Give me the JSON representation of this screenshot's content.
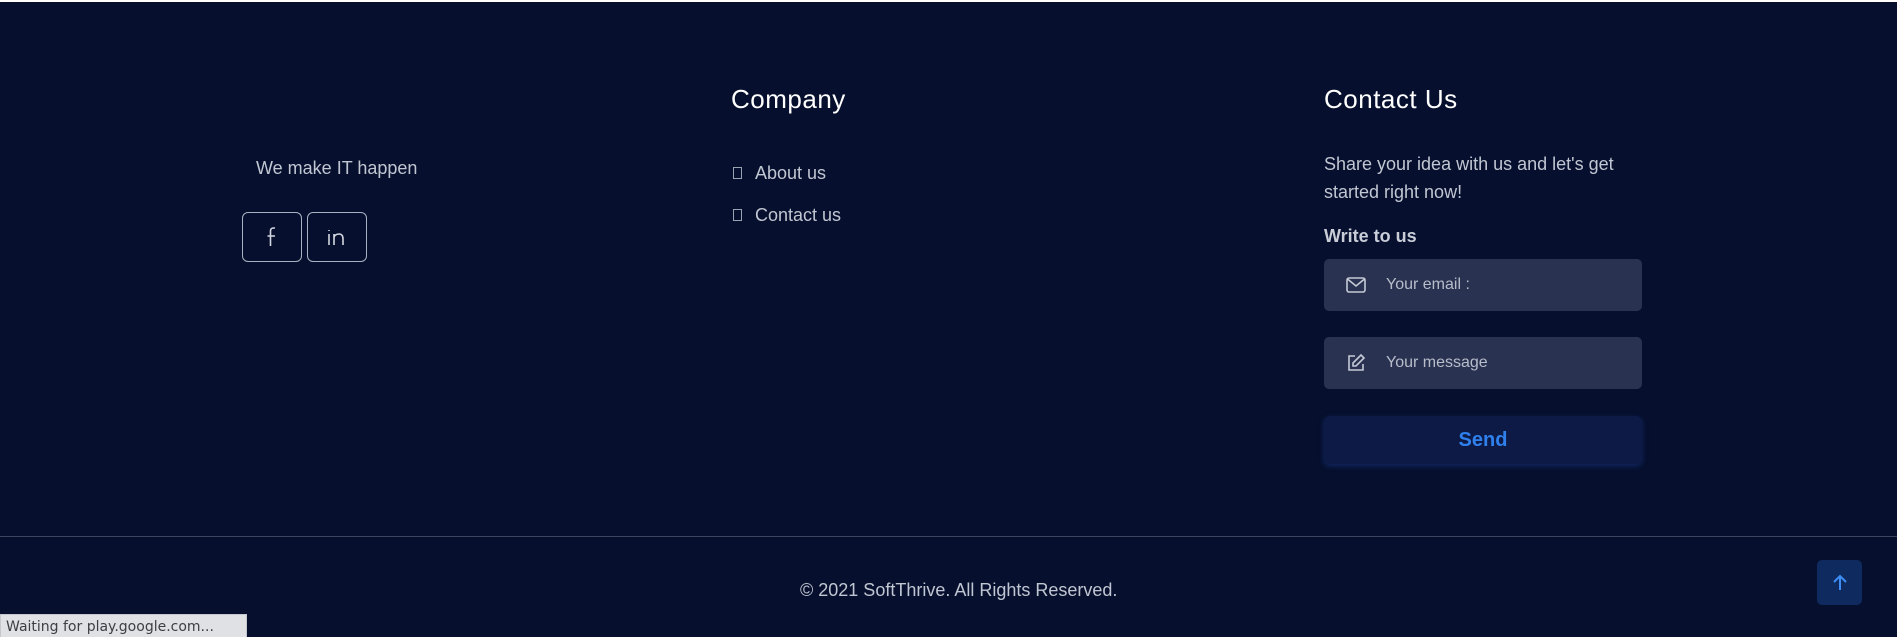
{
  "brand": {
    "tagline": "We make IT happen"
  },
  "socials": [
    {
      "name": "facebook-icon"
    },
    {
      "name": "linkedin-icon"
    }
  ],
  "company": {
    "heading": "Company",
    "links": [
      {
        "label": "About us"
      },
      {
        "label": "Contact us"
      }
    ]
  },
  "contact": {
    "heading": "Contact Us",
    "description": "Share your idea with us and let's get started right now!",
    "write_label": "Write to us",
    "email_placeholder": "Your email :",
    "message_placeholder": "Your message",
    "send_label": "Send"
  },
  "footer": {
    "copyright": "© 2021 SoftThrive. All Rights Reserved."
  },
  "status_bar": {
    "text": "Waiting for play.google.com..."
  },
  "colors": {
    "background": "#060f2d",
    "field_bg": "#293250",
    "accent": "#2f80ed",
    "back_to_top_bg": "#0f2a5e"
  }
}
